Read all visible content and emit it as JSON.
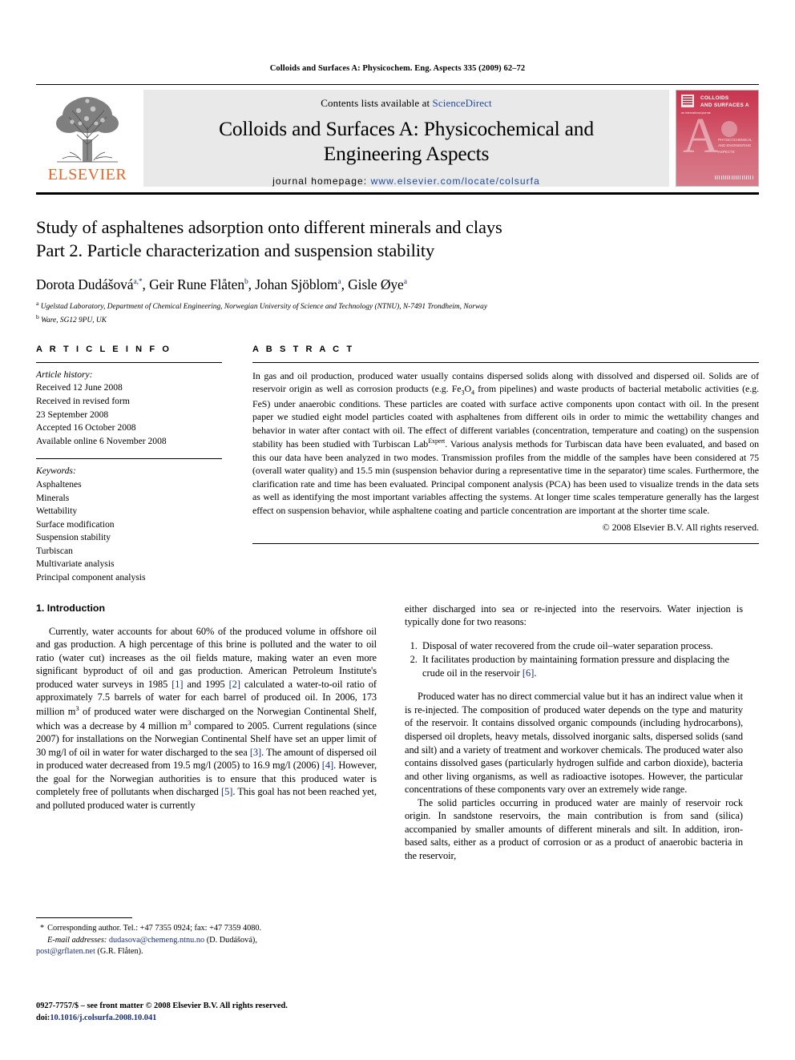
{
  "running_head": "Colloids and Surfaces A: Physicochem. Eng. Aspects 335 (2009) 62–72",
  "masthead": {
    "publisher": "ELSEVIER",
    "contents_prefix": "Contents lists available at ",
    "contents_link": "ScienceDirect",
    "journal_title_line1": "Colloids and Surfaces A: Physicochemical and",
    "journal_title_line2": "Engineering Aspects",
    "homepage_label": "journal homepage:",
    "homepage_url": "www.elsevier.com/locate/colsurfa",
    "cover": {
      "head_line1": "COLLOIDS",
      "head_line2": "AND SURFACES A",
      "sub": "an international journal",
      "letter": "A",
      "lines": "PHYSICOCHEMICAL\nAND ENGINEERING\nASPECTS"
    },
    "accent_orange": "#E8662A",
    "link_blue": "#1e4b9c",
    "cover_red": "#c8354f"
  },
  "article": {
    "title_line1": "Study of asphaltenes adsorption onto different minerals and clays",
    "title_line2": "Part 2. Particle characterization and suspension stability",
    "authors": [
      {
        "name": "Dorota Dudášová",
        "marks": "a,*"
      },
      {
        "name": "Geir Rune Flåten",
        "marks": "b"
      },
      {
        "name": "Johan Sjöblom",
        "marks": "a"
      },
      {
        "name": "Gisle Øye",
        "marks": "a"
      }
    ],
    "affiliations": [
      {
        "mark": "a",
        "text": "Ugelstad Laboratory, Department of Chemical Engineering, Norwegian University of Science and Technology (NTNU), N-7491 Trondheim, Norway"
      },
      {
        "mark": "b",
        "text": "Ware, SG12 9PU, UK"
      }
    ]
  },
  "info": {
    "heading": "A R T I C L E   I N F O",
    "history_label": "Article history:",
    "history": [
      "Received 12 June 2008",
      "Received in revised form",
      "23 September 2008",
      "Accepted 16 October 2008",
      "Available online 6 November 2008"
    ],
    "keywords_label": "Keywords:",
    "keywords": [
      "Asphaltenes",
      "Minerals",
      "Wettability",
      "Surface modification",
      "Suspension stability",
      "Turbiscan",
      "Multivariate analysis",
      "Principal component analysis"
    ]
  },
  "abstract": {
    "heading": "A B S T R A C T",
    "part1": "In gas and oil production, produced water usually contains dispersed solids along with dissolved and dispersed oil. Solids are of reservoir origin as well as corrosion products (e.g. Fe",
    "sub1": "3",
    "part2": "O",
    "sub2": "4",
    "part3": " from pipelines) and waste products of bacterial metabolic activities (e.g. FeS) under anaerobic conditions. These particles are coated with surface active components upon contact with oil. In the present paper we studied eight model particles coated with asphaltenes from different oils in order to mimic the wettability changes and behavior in water after contact with oil. The effect of different variables (concentration, temperature and coating) on the suspension stability has been studied with Turbiscan Lab",
    "sup1": "Expert",
    "part4": ". Various analysis methods for Turbiscan data have been evaluated, and based on this our data have been analyzed in two modes. Transmission profiles from the middle of the samples have been considered at 75 (overall water quality) and 15.5 min (suspension behavior during a representative time in the separator) time scales. Furthermore, the clarification rate and time has been evaluated. Principal component analysis (PCA) has been used to visualize trends in the data sets as well as identifying the most important variables affecting the systems. At longer time scales temperature generally has the largest effect on suspension behavior, while asphaltene coating and particle concentration are important at the shorter time scale.",
    "copyright": "© 2008 Elsevier B.V. All rights reserved."
  },
  "body": {
    "section_heading": "1. Introduction",
    "left_p1_a": "Currently, water accounts for about 60% of the produced volume in offshore oil and gas production. A high percentage of this brine is polluted and the water to oil ratio (water cut) increases as the oil fields mature, making water an even more significant byproduct of oil and gas production. American Petroleum Institute's produced water surveys in 1985 ",
    "left_ref1": "[1]",
    "left_p1_b": " and 1995 ",
    "left_ref2": "[2]",
    "left_p1_c": " calculated a water-to-oil ratio of approximately 7.5 barrels of water for each barrel of produced oil. In 2006, 173 million m",
    "left_sup1": "3",
    "left_p1_d": " of produced water were discharged on the Norwegian Continental Shelf, which was a decrease by 4 million m",
    "left_sup2": "3",
    "left_p1_e": " compared to 2005. Current regulations (since 2007) for installations on the Norwegian Continental Shelf have set an upper limit of 30 mg/l of oil in water for water discharged to the sea ",
    "left_ref3": "[3]",
    "left_p1_f": ". The amount of dispersed oil in produced water decreased from 19.5 mg/l (2005) to 16.9 mg/l (2006) ",
    "left_ref4": "[4]",
    "left_p1_g": ". However, the goal for the Norwegian authorities is to ensure that this produced water is completely free of pollutants when discharged ",
    "left_ref5": "[5]",
    "left_p1_h": ". This goal has not been reached yet, and polluted produced water is currently",
    "right_p1": "either discharged into sea or re-injected into the reservoirs. Water injection is typically done for two reasons:",
    "reasons": [
      {
        "text_a": "Disposal of water recovered from the crude oil–water separation process.",
        "ref": "",
        "text_b": ""
      },
      {
        "text_a": "It facilitates production by maintaining formation pressure and displacing the crude oil in the reservoir ",
        "ref": "[6]",
        "text_b": "."
      }
    ],
    "right_p2": "Produced water has no direct commercial value but it has an indirect value when it is re-injected. The composition of produced water depends on the type and maturity of the reservoir. It contains dissolved organic compounds (including hydrocarbons), dispersed oil droplets, heavy metals, dissolved inorganic salts, dispersed solids (sand and silt) and a variety of treatment and workover chemicals. The produced water also contains dissolved gases (particularly hydrogen sulfide and carbon dioxide), bacteria and other living organisms, as well as radioactive isotopes. However, the particular concentrations of these components vary over an extremely wide range.",
    "right_p3": "The solid particles occurring in produced water are mainly of reservoir rock origin. In sandstone reservoirs, the main contribution is from sand (silica) accompanied by smaller amounts of different minerals and silt. In addition, iron-based salts, either as a product of corrosion or as a product of anaerobic bacteria in the reservoir,"
  },
  "footnote": {
    "star": "*",
    "corresponding": "Corresponding author. Tel.: +47 7355 0924; fax: +47 7359 4080.",
    "email_label": "E-mail addresses:",
    "email1": "dudasova@chemeng.ntnu.no",
    "email1_owner": " (D. Dudášová),",
    "email2": "post@grflaten.net",
    "email2_owner": " (G.R. Flåten)."
  },
  "colophon": {
    "issn_line": "0927-7757/$ – see front matter © 2008 Elsevier B.V. All rights reserved.",
    "doi_label": "doi:",
    "doi_value": "10.1016/j.colsurfa.2008.10.041"
  }
}
